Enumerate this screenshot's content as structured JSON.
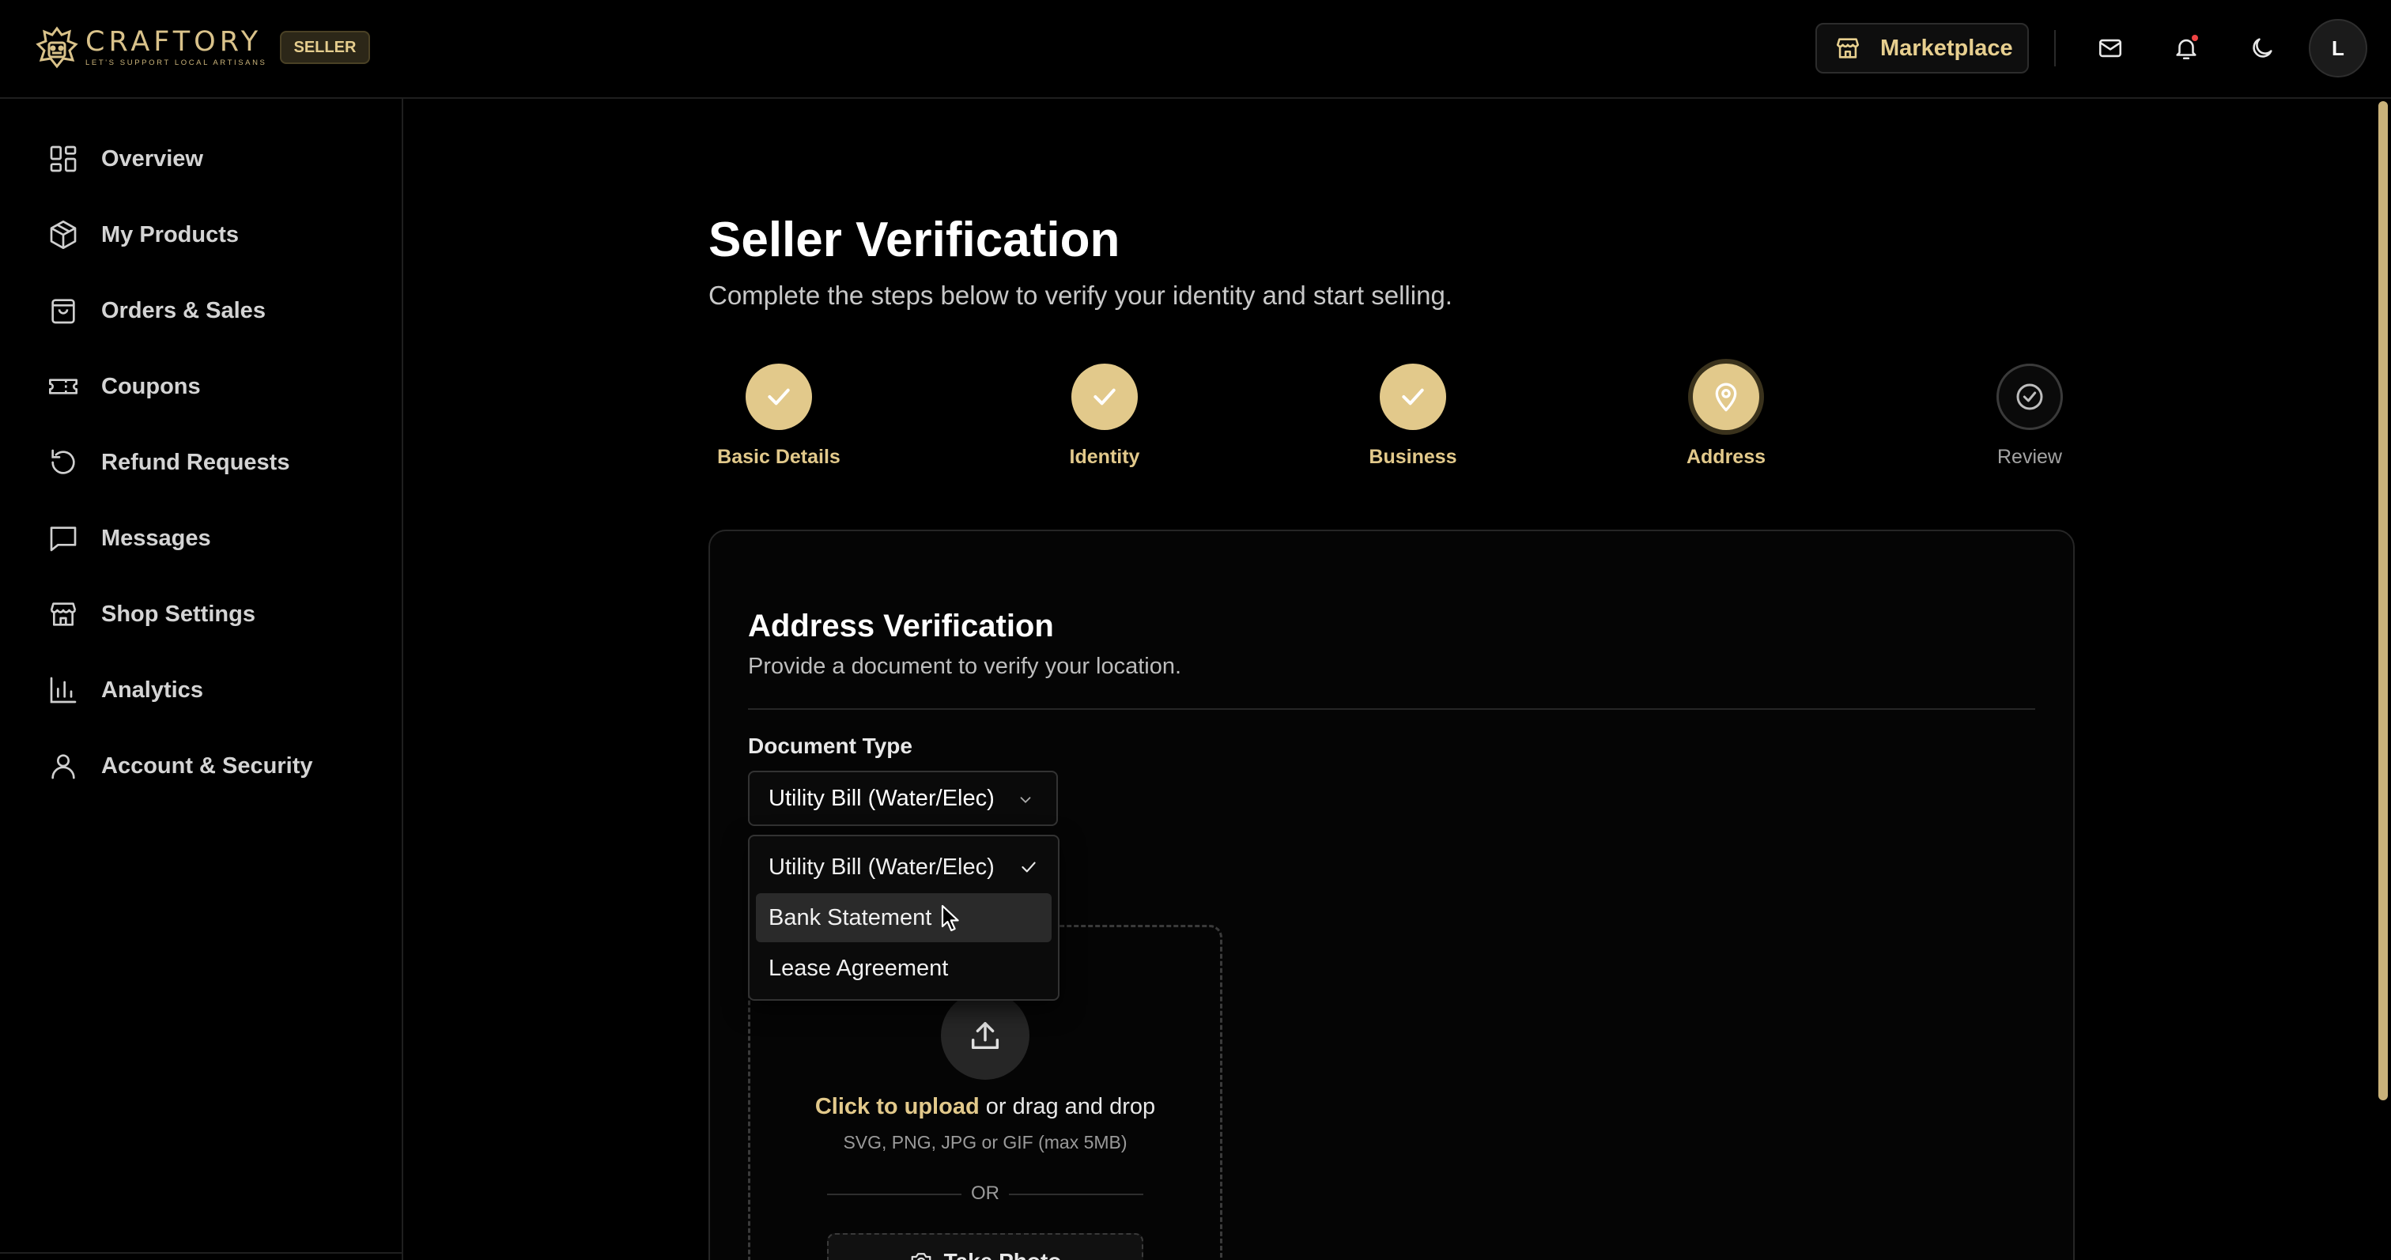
{
  "brand": {
    "name": "CRAFTORY",
    "tagline": "LET'S SUPPORT LOCAL ARTISANS",
    "badge": "SELLER",
    "accent": "#e2c98b"
  },
  "header": {
    "marketplace_label": "Marketplace",
    "avatar_initial": "L"
  },
  "sidebar": {
    "items": [
      {
        "label": "Overview",
        "icon": "grid-icon"
      },
      {
        "label": "My Products",
        "icon": "box-icon"
      },
      {
        "label": "Orders & Sales",
        "icon": "shopping-bag-icon"
      },
      {
        "label": "Coupons",
        "icon": "ticket-icon"
      },
      {
        "label": "Refund Requests",
        "icon": "refresh-icon"
      },
      {
        "label": "Messages",
        "icon": "message-icon"
      },
      {
        "label": "Shop Settings",
        "icon": "store-icon"
      },
      {
        "label": "Analytics",
        "icon": "bar-chart-icon"
      },
      {
        "label": "Account & Security",
        "icon": "user-icon"
      }
    ]
  },
  "page": {
    "title": "Seller Verification",
    "subtitle": "Complete the steps below to verify your identity and start selling."
  },
  "steps": [
    {
      "label": "Basic Details",
      "status": "complete"
    },
    {
      "label": "Identity",
      "status": "complete"
    },
    {
      "label": "Business",
      "status": "complete"
    },
    {
      "label": "Address",
      "status": "current"
    },
    {
      "label": "Review",
      "status": "pending"
    }
  ],
  "card": {
    "title": "Address Verification",
    "subtitle": "Provide a document to verify your location.",
    "doc_type_label": "Document Type",
    "doc_type_selected": "Utility Bill (Water/Elec)",
    "options": [
      "Utility Bill (Water/Elec)",
      "Bank Statement",
      "Lease Agreement"
    ],
    "upload": {
      "link_text": "Click to upload",
      "rest_text": " or drag and drop",
      "hint": "SVG, PNG, JPG or GIF (max 5MB)",
      "or": "OR",
      "photo_button": "Take Photo"
    }
  }
}
